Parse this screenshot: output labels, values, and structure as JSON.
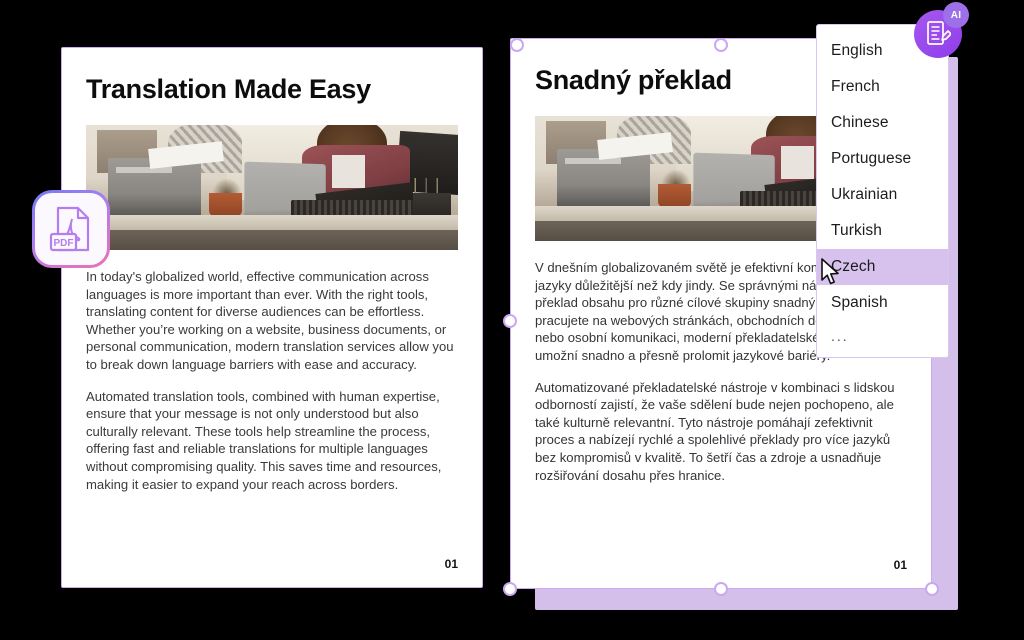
{
  "canvas": {
    "background_color": "#000000",
    "accent_color": "#8f3ee8",
    "selection_color": "#c9a8f2",
    "highlight_color": "#d7c2ee"
  },
  "documents": [
    {
      "id": "source-document",
      "language": "English",
      "title": "Translation Made Easy",
      "image_alt": "office-desk-photo",
      "paragraphs": [
        "In today's globalized world, effective communication across languages is more important than ever. With the right tools, translating content for diverse audiences can be effortless. Whether you’re working on a website, business documents, or personal communication, modern translation services allow you to break down language barriers with ease and accuracy.",
        "Automated translation tools, combined with human expertise, ensure that your message is not only understood but also culturally relevant. These tools help streamline the process, offering fast and reliable translations for multiple languages without compromising quality. This saves time and resources, making it easier to expand your reach across borders."
      ],
      "page_number": "01"
    },
    {
      "id": "translated-document",
      "language": "Czech",
      "title": "Snadný překlad",
      "image_alt": "office-desk-photo",
      "paragraphs": [
        "V dnešním globalizovaném světě je efektivní komunikace napříč jazyky důležitější než kdy jindy. Se správnými nástroji může být překlad obsahu pro různé cílové skupiny snadný. Ať už pracujete na webových stránkách, obchodních dokumentech nebo osobní komunikaci, moderní překladatelské služby vám umožní snadno a přesně prolomit jazykové bariéry.",
        "Automatizované překladatelské nástroje v kombinaci s lidskou odborností zajistí, že vaše sdělení bude nejen pochopeno, ale také kulturně relevantní. Tyto nástroje pomáhají zefektivnit proces a nabízejí rychlé a spolehlivé překlady pro více jazyků bez kompromisů v kvalitě. To šetří čas a zdroje a usnadňuje rozšiřování dosahu přes hranice."
      ],
      "page_number": "01"
    }
  ],
  "language_dropdown": {
    "selected": "Czech",
    "options": [
      {
        "label": "English",
        "selected": false
      },
      {
        "label": "French",
        "selected": false
      },
      {
        "label": "Chinese",
        "selected": false
      },
      {
        "label": "Portuguese",
        "selected": false
      },
      {
        "label": "Ukrainian",
        "selected": false
      },
      {
        "label": "Turkish",
        "selected": false
      },
      {
        "label": "Czech",
        "selected": true
      },
      {
        "label": "Spanish",
        "selected": false
      },
      {
        "label": "...",
        "selected": false
      }
    ]
  },
  "badges": {
    "ai_label": "AI",
    "ai_icon": "document-edit-icon",
    "pdf_label": "PDF",
    "pdf_icon": "pdf-file-icon"
  }
}
